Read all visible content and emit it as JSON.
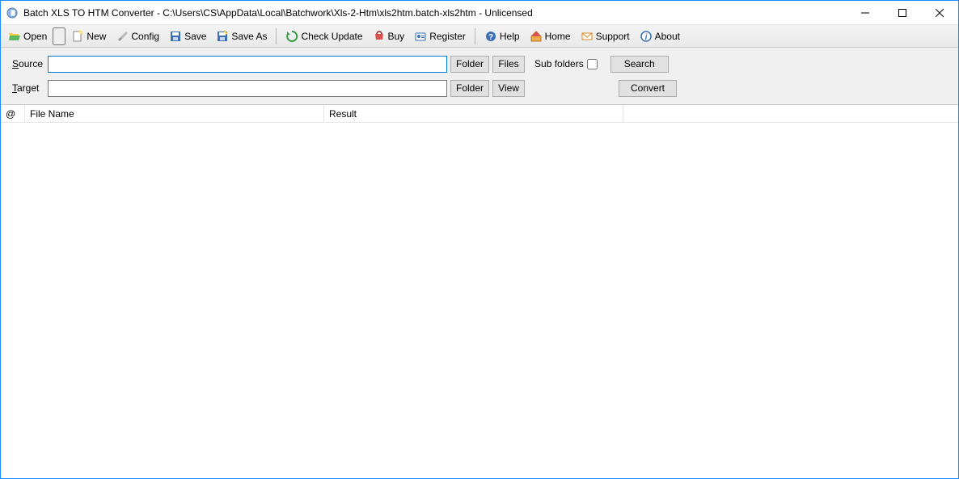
{
  "window": {
    "title": "Batch XLS TO HTM Converter - C:\\Users\\CS\\AppData\\Local\\Batchwork\\Xls-2-Htm\\xls2htm.batch-xls2htm - Unlicensed"
  },
  "toolbar": {
    "open": "Open",
    "new": "New",
    "config": "Config",
    "save": "Save",
    "save_as": "Save As",
    "check_update": "Check Update",
    "buy": "Buy",
    "register": "Register",
    "help": "Help",
    "home": "Home",
    "support": "Support",
    "about": "About"
  },
  "form": {
    "source_prefix": "S",
    "source_rest": "ource",
    "target_prefix": "T",
    "target_rest": "arget",
    "source_value": "",
    "target_value": "",
    "folder": "Folder",
    "files": "Files",
    "view": "View",
    "sub_folders": "Sub folders",
    "search": "Search",
    "convert": "Convert"
  },
  "grid": {
    "col_at": "@",
    "col_file": "File Name",
    "col_result": "Result"
  }
}
